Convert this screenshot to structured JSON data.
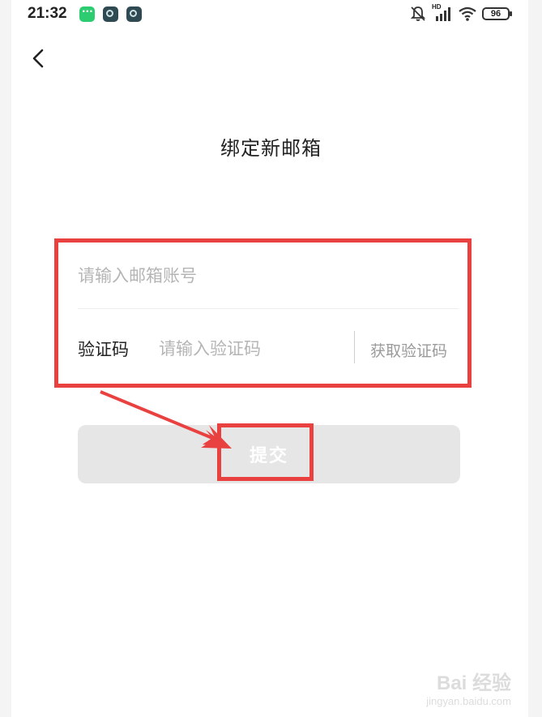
{
  "status_bar": {
    "time": "21:32",
    "network_badge": "HD",
    "battery": "96",
    "app_icons": [
      "chat-app-icon",
      "app-icon",
      "app-icon"
    ]
  },
  "header": {
    "back_icon": "chevron-left-icon",
    "title": "绑定新邮箱"
  },
  "form": {
    "email_placeholder": "请输入邮箱账号",
    "email_value": "",
    "code_label": "验证码",
    "code_placeholder": "请输入验证码",
    "code_value": "",
    "get_code_label": "获取验证码"
  },
  "submit": {
    "label": "提交"
  },
  "annotations": {
    "highlight_color": "#e94040"
  },
  "watermark": {
    "main": "Bai 经验",
    "sub": "jingyan.baidu.com"
  }
}
